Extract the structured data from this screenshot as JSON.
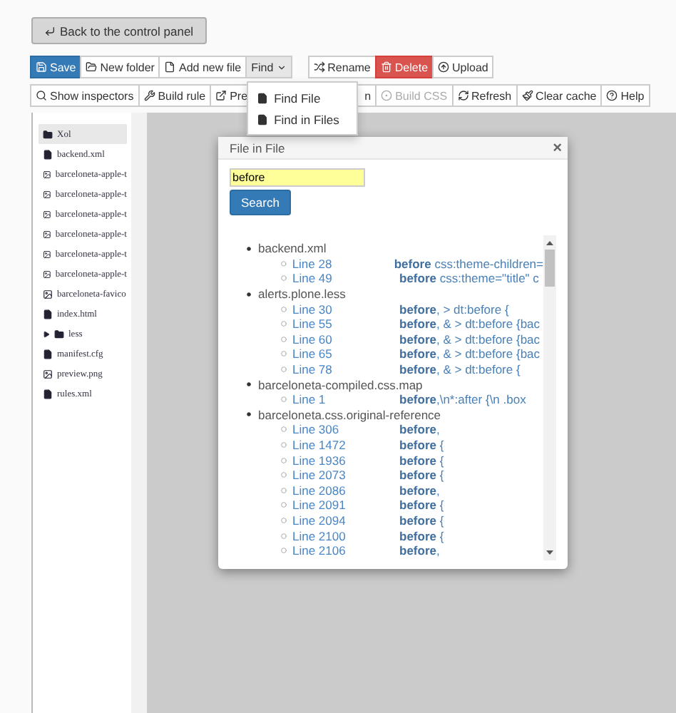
{
  "back_button": "Back to the control panel",
  "toolbar": [
    [
      {
        "label": "Save",
        "kind": "primary"
      },
      {
        "label": "New folder",
        "kind": "default"
      },
      {
        "label": "Add new file",
        "kind": "default"
      },
      {
        "label": "Find",
        "kind": "default",
        "expanded": true
      }
    ],
    [
      {
        "label": "Rename",
        "kind": "default"
      },
      {
        "label": "Delete",
        "kind": "danger"
      },
      {
        "label": "Upload",
        "kind": "default"
      }
    ]
  ],
  "toolbar_2": [
    {
      "label": "Show inspectors",
      "disabled": false
    },
    {
      "label": "Build rule",
      "disabled": false
    },
    {
      "label": "Pre",
      "disabled": false
    },
    {
      "label": "n",
      "disabled": false
    },
    {
      "label": "Build CSS",
      "disabled": true
    },
    {
      "label": "Refresh",
      "disabled": false
    },
    {
      "label": "Clear cache",
      "disabled": false
    },
    {
      "label": "Help",
      "disabled": false
    }
  ],
  "find_menu": [
    "Find File",
    "Find in Files"
  ],
  "file_tree": [
    {
      "name": "Xol",
      "kind": "folder",
      "selected": true
    },
    {
      "name": "backend.xml",
      "kind": "file",
      "selected": false
    },
    {
      "name": "barceloneta-apple-t",
      "kind": "image",
      "selected": false
    },
    {
      "name": "barceloneta-apple-t",
      "kind": "image",
      "selected": false
    },
    {
      "name": "barceloneta-apple-t",
      "kind": "image",
      "selected": false
    },
    {
      "name": "barceloneta-apple-t",
      "kind": "image",
      "selected": false
    },
    {
      "name": "barceloneta-apple-t",
      "kind": "image",
      "selected": false
    },
    {
      "name": "barceloneta-apple-t",
      "kind": "image",
      "selected": false
    },
    {
      "name": "barceloneta-favico",
      "kind": "image",
      "selected": false
    },
    {
      "name": "index.html",
      "kind": "file",
      "selected": false
    },
    {
      "name": "less",
      "kind": "folder",
      "selected": false,
      "expanded": false
    },
    {
      "name": "manifest.cfg",
      "kind": "file",
      "selected": false
    },
    {
      "name": "preview.png",
      "kind": "image",
      "selected": false
    },
    {
      "name": "rules.xml",
      "kind": "file",
      "selected": false
    }
  ],
  "dialog": {
    "title": "File in File",
    "close": "×",
    "search_value": "before",
    "search_button": "Search",
    "results": [
      {
        "file": "backend.xml",
        "matches": [
          {
            "line": "Line 28",
            "text": "**before** css:theme-children="
          },
          {
            "line": "Line 49",
            "text": "**before** css:theme=\"title\" c"
          }
        ]
      },
      {
        "file": "alerts.plone.less",
        "matches": [
          {
            "line": "Line 30",
            "text": "**before**, > dt:before {"
          },
          {
            "line": "Line 55",
            "text": "**before**, & > dt:before {bac"
          },
          {
            "line": "Line 60",
            "text": "**before**, & > dt:before {bac"
          },
          {
            "line": "Line 65",
            "text": "**before**, & > dt:before {bac"
          },
          {
            "line": "Line 78",
            "text": "**before**, & > dt:before {"
          }
        ]
      },
      {
        "file": "barceloneta-compiled.css.map",
        "matches": [
          {
            "line": "Line 1",
            "text": "**before**,\\n*:after {\\n .box"
          }
        ]
      },
      {
        "file": "barceloneta.css.original-reference",
        "matches": [
          {
            "line": "Line 306",
            "text": "**before**,"
          },
          {
            "line": "Line 1472",
            "text": "**before** {"
          },
          {
            "line": "Line 1936",
            "text": "**before** {"
          },
          {
            "line": "Line 2073",
            "text": "**before** {"
          },
          {
            "line": "Line 2086",
            "text": "**before**,"
          },
          {
            "line": "Line 2091",
            "text": "**before** {"
          },
          {
            "line": "Line 2094",
            "text": "**before** {"
          },
          {
            "line": "Line 2100",
            "text": "**before** {"
          },
          {
            "line": "Line 2106",
            "text": "**before**,"
          }
        ]
      }
    ]
  }
}
